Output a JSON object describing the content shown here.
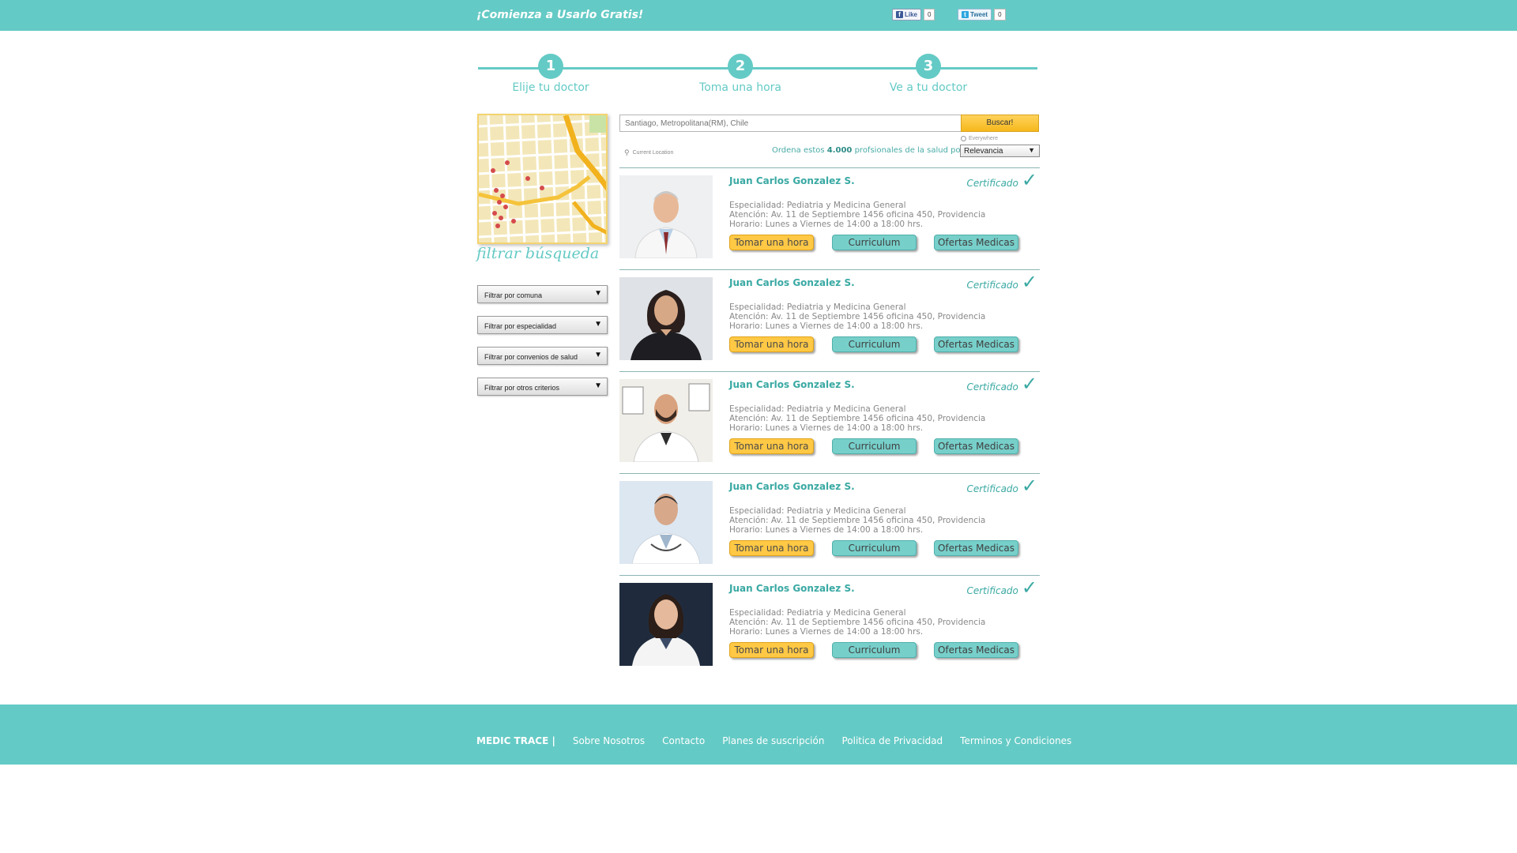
{
  "header": {
    "tagline": "¡Comienza a Usarlo Gratis!",
    "facebook": {
      "label": "Like",
      "count": "0"
    },
    "twitter": {
      "label": "Tweet",
      "count": "0"
    }
  },
  "steps": [
    {
      "number": "1",
      "label": "Elije tu doctor"
    },
    {
      "number": "2",
      "label": "Toma una hora"
    },
    {
      "number": "3",
      "label": "Ve a tu doctor"
    }
  ],
  "sidebar": {
    "filter_title": "filtrar búsqueda",
    "filters": [
      "Filtrar por comuna",
      "Filtrar por especialidad",
      "Filtrar por convenios de salud",
      "Filtrar por otros criterios"
    ]
  },
  "search": {
    "placeholder": "Santiago, Metropolitana(RM), Chile",
    "button": "Buscar!",
    "everywhere": "Everywhere",
    "current_location": "Current Location",
    "sort_prefix": "Ordena estos",
    "sort_count": "4.000",
    "sort_suffix": "profsionales de la salud por:",
    "sort_value": "Relevancia"
  },
  "results": [
    {
      "name": "Juan Carlos Gonzalez S.",
      "certified": "Certificado",
      "specialty": "Especialidad: Pediatria y Medicina General",
      "address": "Atención: Av. 11 de Septiembre 1456 oficina 450, Providencia",
      "hours": "Horario: Lunes a Viernes de 14:00 a 18:00 hrs.",
      "book": "Tomar una hora",
      "cv": "Curriculum",
      "offers": "Ofertas Medicas"
    },
    {
      "name": "Juan Carlos Gonzalez S.",
      "certified": "Certificado",
      "specialty": "Especialidad: Pediatria y Medicina General",
      "address": "Atención: Av. 11 de Septiembre 1456 oficina 450, Providencia",
      "hours": "Horario: Lunes a Viernes de 14:00 a 18:00 hrs.",
      "book": "Tomar una hora",
      "cv": "Curriculum",
      "offers": "Ofertas Medicas"
    },
    {
      "name": "Juan Carlos Gonzalez S.",
      "certified": "Certificado",
      "specialty": "Especialidad: Pediatria y Medicina General",
      "address": "Atención: Av. 11 de Septiembre 1456 oficina 450, Providencia",
      "hours": "Horario: Lunes a Viernes de 14:00 a 18:00 hrs.",
      "book": "Tomar una hora",
      "cv": "Curriculum",
      "offers": "Ofertas Medicas"
    },
    {
      "name": "Juan Carlos Gonzalez S.",
      "certified": "Certificado",
      "specialty": "Especialidad: Pediatria y Medicina General",
      "address": "Atención: Av. 11 de Septiembre 1456 oficina 450, Providencia",
      "hours": "Horario: Lunes a Viernes de 14:00 a 18:00 hrs.",
      "book": "Tomar una hora",
      "cv": "Curriculum",
      "offers": "Ofertas Medicas"
    },
    {
      "name": "Juan Carlos Gonzalez S.",
      "certified": "Certificado",
      "specialty": "Especialidad: Pediatria y Medicina General",
      "address": "Atención: Av. 11 de Septiembre 1456 oficina 450, Providencia",
      "hours": "Horario: Lunes a Viernes de 14:00 a 18:00 hrs.",
      "book": "Tomar una hora",
      "cv": "Curriculum",
      "offers": "Ofertas Medicas"
    }
  ],
  "footer": {
    "brand": "MEDIC TRACE  |",
    "links": [
      "Sobre Nosotros",
      "Contacto",
      "Planes de suscripción",
      "Politica de Privacidad",
      "Terminos y Condiciones"
    ]
  },
  "colors": {
    "accent": "#64cac5",
    "button_yellow": "#ffc845",
    "button_teal": "#77cfca"
  },
  "icons": {
    "location": "map-pin-icon",
    "certified": "checkmark-icon",
    "dropdown": "triangle-down-icon"
  }
}
